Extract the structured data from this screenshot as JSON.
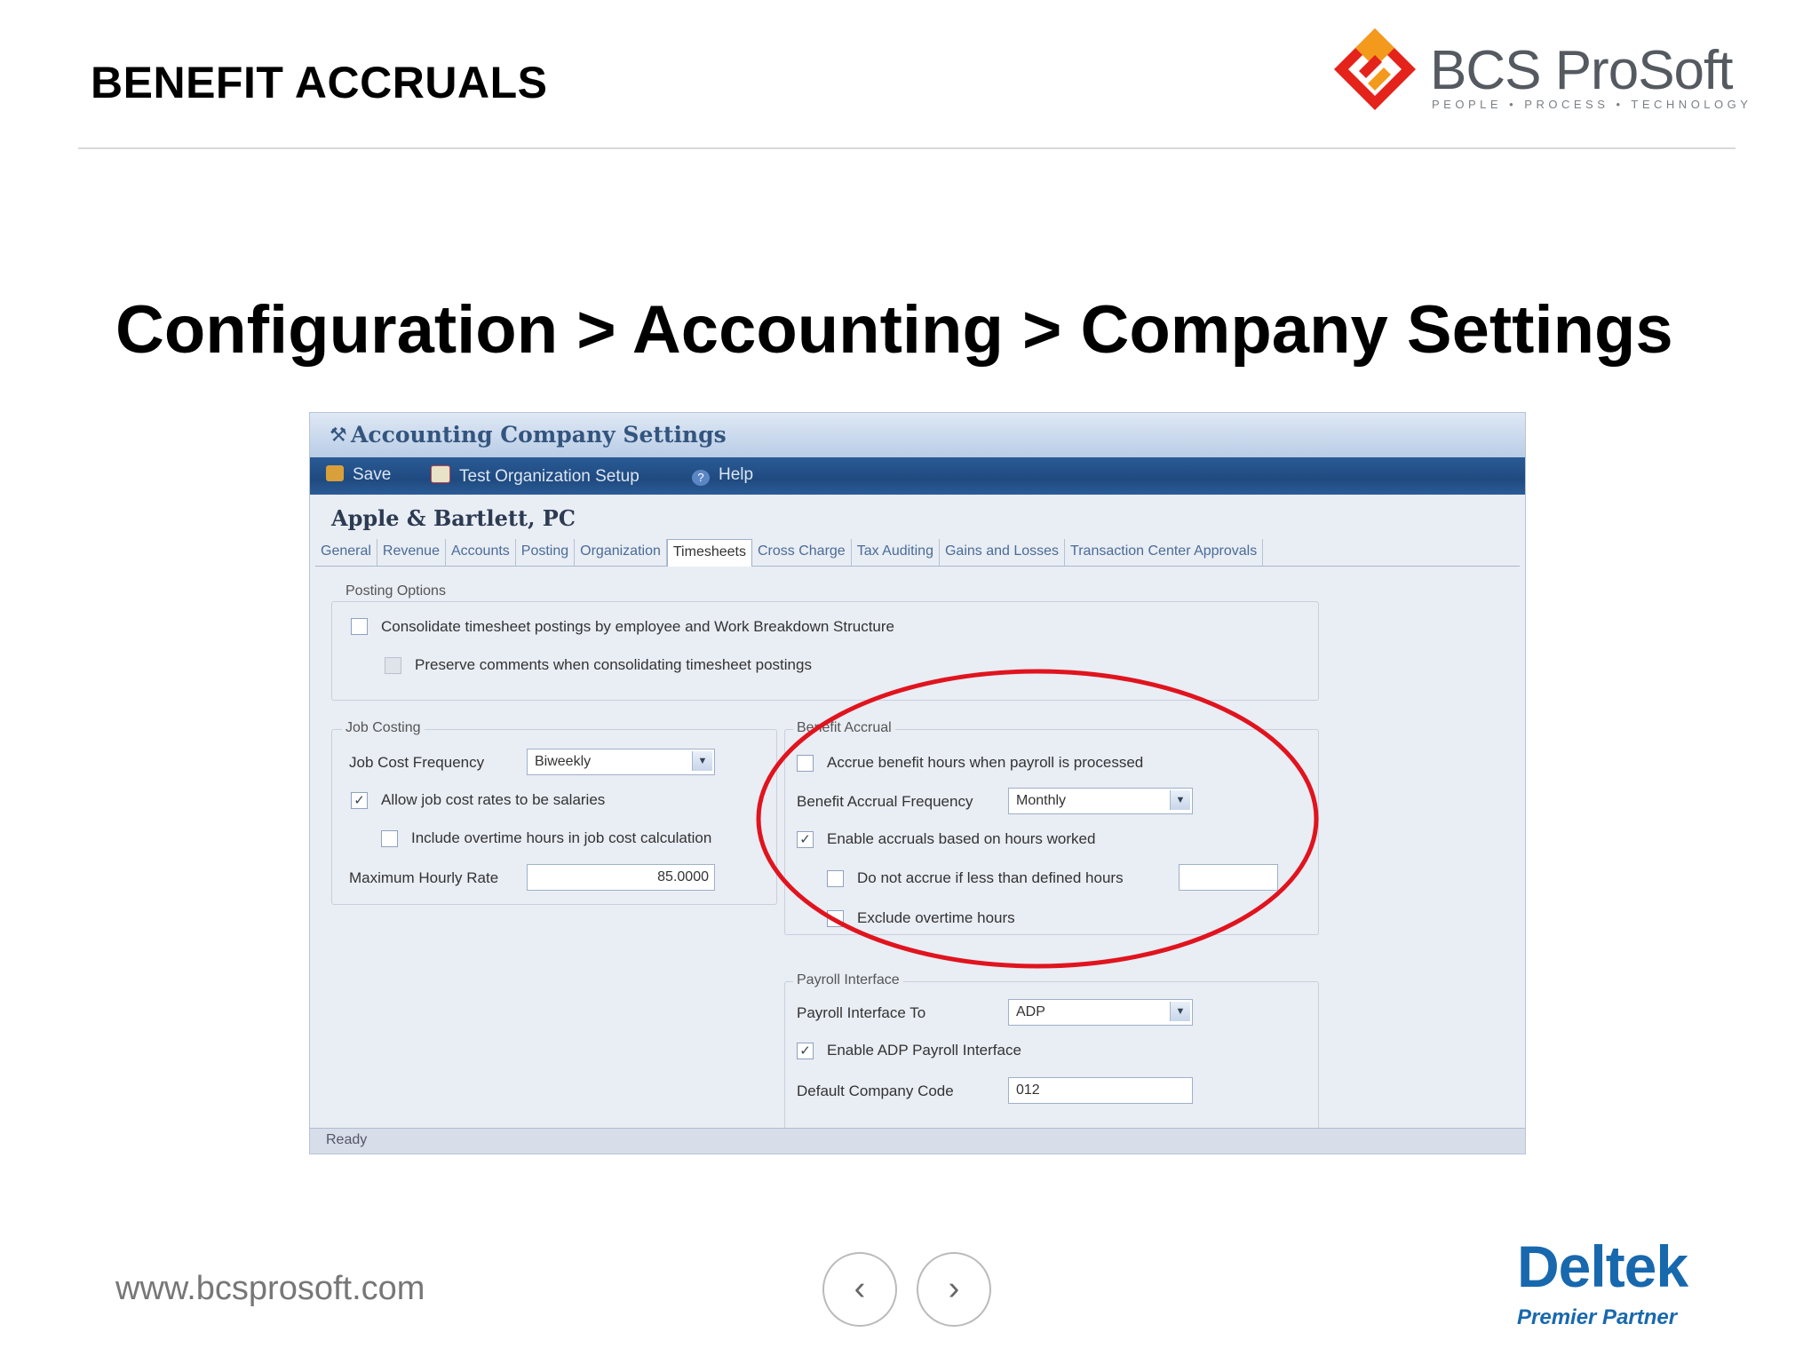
{
  "header": {
    "title": "BENEFIT ACCRUALS"
  },
  "brand": {
    "logo_text": "BCS ProSoft",
    "tagline": "PEOPLE • PROCESS • TECHNOLOGY"
  },
  "slide": {
    "title": "Configuration > Accounting > Company Settings"
  },
  "app": {
    "window_title": "Accounting Company Settings",
    "toolbar": {
      "save": "Save",
      "test_org": "Test Organization Setup",
      "help": "Help"
    },
    "company_name": "Apple & Bartlett, PC",
    "tabs": [
      "General",
      "Revenue",
      "Accounts",
      "Posting",
      "Organization",
      "Timesheets",
      "Cross Charge",
      "Tax Auditing",
      "Gains and Losses",
      "Transaction Center Approvals"
    ],
    "active_tab": "Timesheets",
    "posting_options": {
      "legend": "Posting Options",
      "consolidate": {
        "label": "Consolidate timesheet postings by employee and Work Breakdown Structure",
        "checked": false
      },
      "preserve_comments": {
        "label": "Preserve comments when consolidating timesheet postings",
        "checked": false
      }
    },
    "job_costing": {
      "legend": "Job Costing",
      "frequency_label": "Job Cost Frequency",
      "frequency_value": "Biweekly",
      "allow_salaries": {
        "label": "Allow job cost rates to be salaries",
        "checked": true
      },
      "include_overtime": {
        "label": "Include overtime hours in job cost calculation",
        "checked": false
      },
      "max_rate_label": "Maximum Hourly Rate",
      "max_rate_value": "85.0000"
    },
    "benefit_accrual": {
      "legend": "Benefit Accrual",
      "accrue_when_payroll": {
        "label": "Accrue benefit hours when payroll is processed",
        "checked": false
      },
      "frequency_label": "Benefit Accrual Frequency",
      "frequency_value": "Monthly",
      "enable_based_on_hours": {
        "label": "Enable accruals based on hours worked",
        "checked": true
      },
      "do_not_accrue": {
        "label": "Do not accrue if less than defined hours",
        "checked": false,
        "value": ""
      },
      "exclude_overtime": {
        "label": "Exclude overtime hours",
        "checked": false
      }
    },
    "payroll_interface": {
      "legend": "Payroll Interface",
      "interface_to_label": "Payroll Interface To",
      "interface_to_value": "ADP",
      "enable_adp": {
        "label": "Enable ADP Payroll Interface",
        "checked": true
      },
      "company_code_label": "Default Company Code",
      "company_code_value": "012"
    },
    "status": "Ready"
  },
  "footer": {
    "website": "www.bcsprosoft.com",
    "prev": "‹",
    "next": "›",
    "partner_name": "Deltek",
    "partner_level": "Premier Partner"
  },
  "colors": {
    "highlight_ring": "#e0141e",
    "toolbar": "#24548c",
    "deltek_blue": "#1868ae"
  }
}
